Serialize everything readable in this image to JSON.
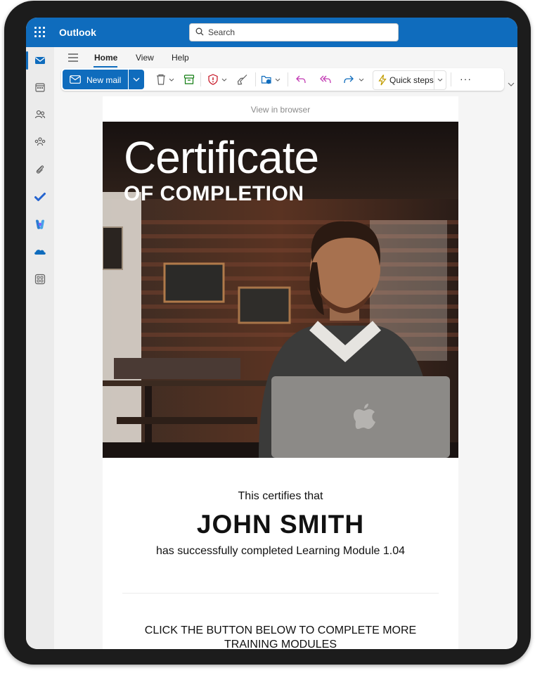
{
  "app": {
    "title": "Outlook"
  },
  "search": {
    "placeholder": "Search"
  },
  "tabs": [
    {
      "label": "Home",
      "active": true
    },
    {
      "label": "View"
    },
    {
      "label": "Help"
    }
  ],
  "ribbon": {
    "new_mail_label": "New mail",
    "quick_steps_label": "Quick steps",
    "more_label": "···"
  },
  "rail": {
    "items": [
      "mail-icon",
      "calendar-icon",
      "people-icon",
      "groups-icon",
      "attachment-icon",
      "todo-icon",
      "copilot-icon",
      "onedrive-icon",
      "apps-icon"
    ]
  },
  "email": {
    "view_in_browser": "View in browser",
    "cert_title": "Certificate",
    "cert_subtitle": "OF COMPLETION",
    "certifies_text": "This certifies that",
    "recipient_name": "JOHN SMITH",
    "completed_text": "has successfully completed Learning Module 1.04",
    "cta_text": "CLICK THE BUTTON BELOW TO COMPLETE MORE TRAINING MODULES"
  },
  "colors": {
    "brand": "#0f6cbd",
    "device": "#1c1c1c"
  }
}
